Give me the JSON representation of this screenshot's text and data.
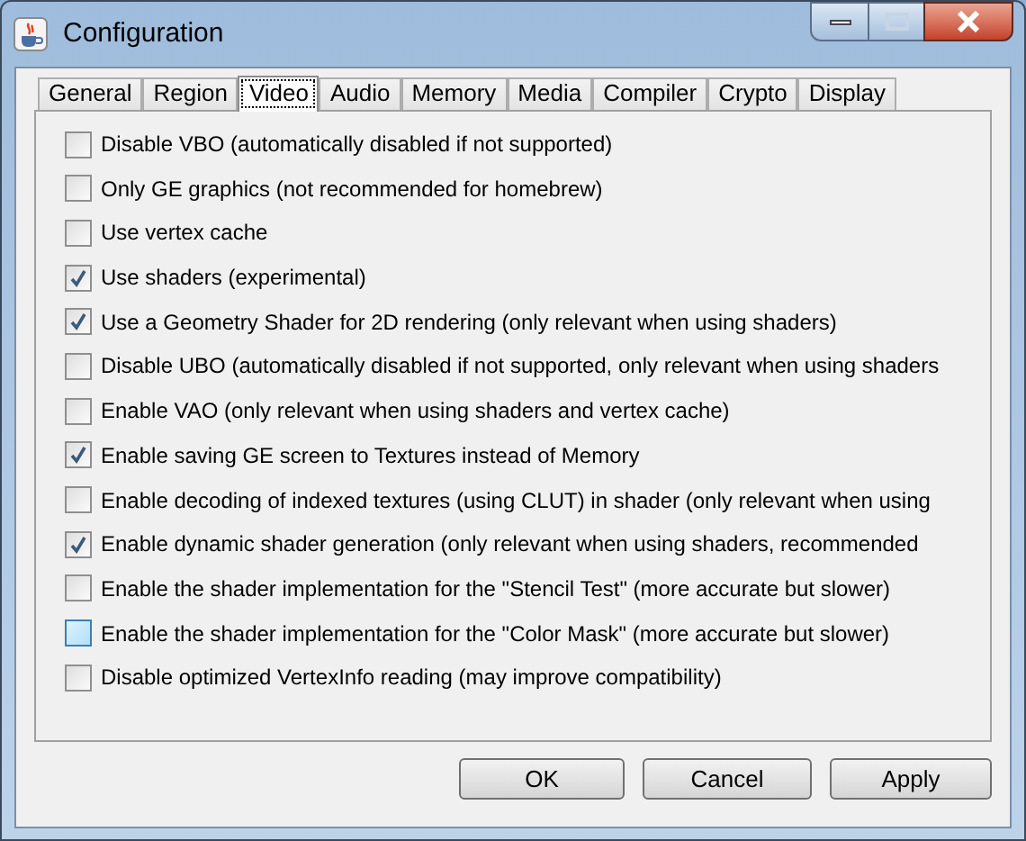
{
  "window": {
    "title": "Configuration"
  },
  "tabs": [
    {
      "label": "General",
      "selected": false
    },
    {
      "label": "Region",
      "selected": false
    },
    {
      "label": "Video",
      "selected": true
    },
    {
      "label": "Audio",
      "selected": false
    },
    {
      "label": "Memory",
      "selected": false
    },
    {
      "label": "Media",
      "selected": false
    },
    {
      "label": "Compiler",
      "selected": false
    },
    {
      "label": "Crypto",
      "selected": false
    },
    {
      "label": "Display",
      "selected": false
    }
  ],
  "options": [
    {
      "label": "Disable VBO (automatically disabled if not supported)",
      "checked": false,
      "hovered": false
    },
    {
      "label": "Only GE graphics (not recommended for homebrew)",
      "checked": false,
      "hovered": false
    },
    {
      "label": "Use vertex cache",
      "checked": false,
      "hovered": false
    },
    {
      "label": "Use shaders (experimental)",
      "checked": true,
      "hovered": false
    },
    {
      "label": "Use a Geometry Shader for 2D rendering (only relevant when using shaders)",
      "checked": true,
      "hovered": false
    },
    {
      "label": "Disable UBO (automatically disabled if not supported, only relevant when using shaders",
      "checked": false,
      "hovered": false
    },
    {
      "label": "Enable VAO (only relevant when using shaders and vertex cache)",
      "checked": false,
      "hovered": false
    },
    {
      "label": "Enable saving GE screen to Textures instead of Memory",
      "checked": true,
      "hovered": false
    },
    {
      "label": "Enable decoding of indexed textures (using CLUT) in shader (only relevant when using",
      "checked": false,
      "hovered": false
    },
    {
      "label": "Enable dynamic shader generation (only relevant when using shaders, recommended",
      "checked": true,
      "hovered": false
    },
    {
      "label": "Enable the shader implementation for the \"Stencil Test\" (more accurate but slower)",
      "checked": false,
      "hovered": false
    },
    {
      "label": "Enable the shader implementation for the \"Color Mask\" (more accurate but slower)",
      "checked": false,
      "hovered": true
    },
    {
      "label": "Disable optimized VertexInfo reading (may improve compatibility)",
      "checked": false,
      "hovered": false
    }
  ],
  "buttons": [
    "OK",
    "Cancel",
    "Apply"
  ]
}
